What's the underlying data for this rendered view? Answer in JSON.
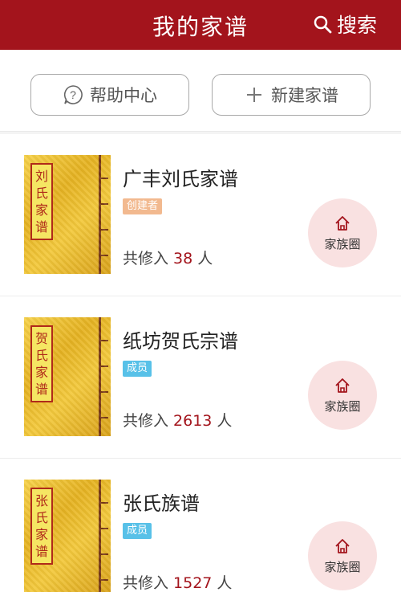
{
  "header": {
    "title": "我的家谱",
    "search_label": "搜索"
  },
  "actions": {
    "help_label": "帮助中心",
    "new_label": "新建家谱"
  },
  "colors": {
    "brand": "#a3141c",
    "creator_badge": "#f2b98f",
    "member_badge": "#58c1e8",
    "circle_bg": "#f9e1e1"
  },
  "genealogies": [
    {
      "name": "广丰刘氏家谱",
      "cover_chars": [
        "刘",
        "氏",
        "家",
        "谱"
      ],
      "role": "创建者",
      "count_prefix": "共修入",
      "count": "38",
      "count_suffix": "人",
      "circle_label": "家族圈"
    },
    {
      "name": "纸坊贺氏宗谱",
      "cover_chars": [
        "贺",
        "氏",
        "家",
        "谱"
      ],
      "role": "成员",
      "count_prefix": "共修入",
      "count": "2613",
      "count_suffix": "人",
      "circle_label": "家族圈"
    },
    {
      "name": "张氏族谱",
      "cover_chars": [
        "张",
        "氏",
        "家",
        "谱"
      ],
      "role": "成员",
      "count_prefix": "共修入",
      "count": "1527",
      "count_suffix": "人",
      "circle_label": "家族圈"
    }
  ]
}
